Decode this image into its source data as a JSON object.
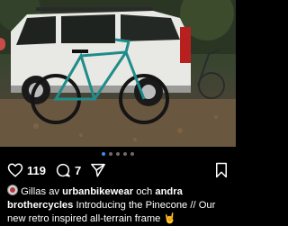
{
  "post": {
    "image_alt": "Teal bike leaning on white station wagon",
    "likes": "119",
    "comments": "7",
    "carousel": {
      "count": 5,
      "active_index": 0
    }
  },
  "caption": {
    "prefix": "Gillas av",
    "user1": "urbanbikewear",
    "conjunction": "och",
    "user2": "andra",
    "author": "brothercycles",
    "text": "Introducing the Pinecone // Our new retro inspired all-terrain frame",
    "emoji": "🤘"
  },
  "icons": {
    "like": "heart-icon",
    "comment": "comment-icon",
    "share": "send-icon",
    "save": "bookmark-icon"
  },
  "colors": {
    "background": "#000000",
    "active_dot": "#3a8ef6",
    "bike_frame": "#1f8c8a",
    "car_body": "#e8e8e4"
  }
}
